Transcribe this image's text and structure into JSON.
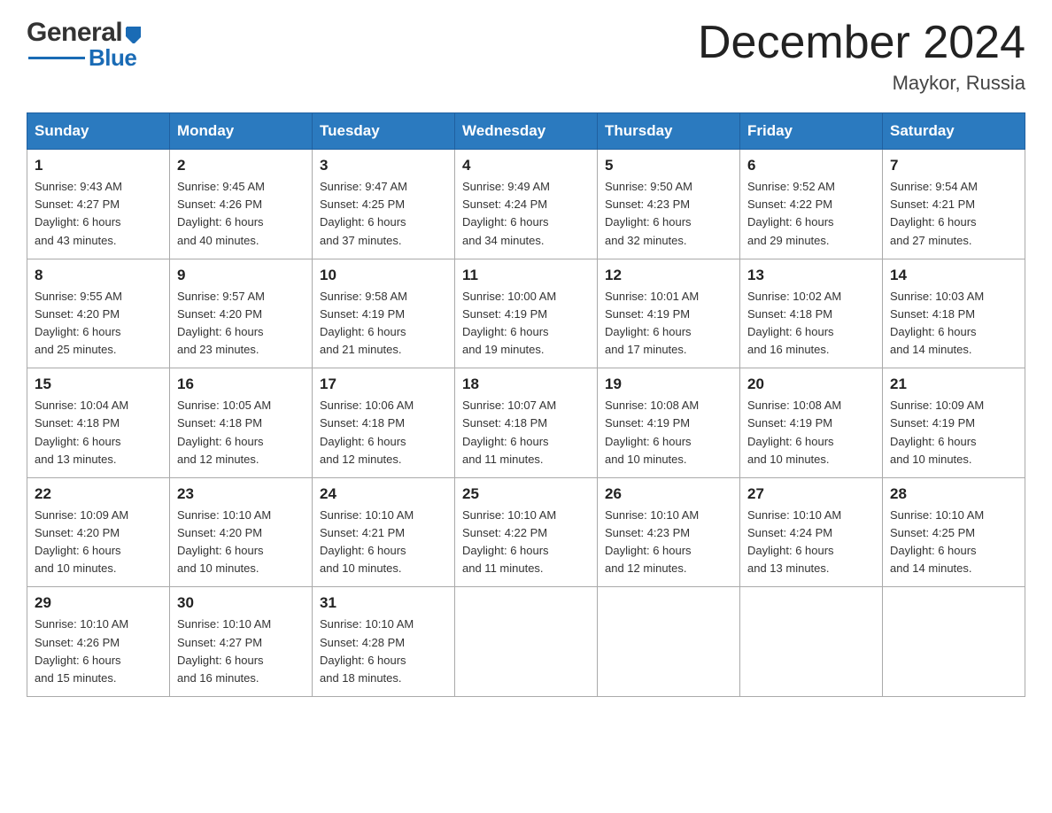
{
  "header": {
    "logo_general": "General",
    "logo_blue": "Blue",
    "month_title": "December 2024",
    "location": "Maykor, Russia"
  },
  "weekdays": [
    "Sunday",
    "Monday",
    "Tuesday",
    "Wednesday",
    "Thursday",
    "Friday",
    "Saturday"
  ],
  "weeks": [
    [
      {
        "day": "1",
        "sunrise": "9:43 AM",
        "sunset": "4:27 PM",
        "daylight": "6 hours and 43 minutes."
      },
      {
        "day": "2",
        "sunrise": "9:45 AM",
        "sunset": "4:26 PM",
        "daylight": "6 hours and 40 minutes."
      },
      {
        "day": "3",
        "sunrise": "9:47 AM",
        "sunset": "4:25 PM",
        "daylight": "6 hours and 37 minutes."
      },
      {
        "day": "4",
        "sunrise": "9:49 AM",
        "sunset": "4:24 PM",
        "daylight": "6 hours and 34 minutes."
      },
      {
        "day": "5",
        "sunrise": "9:50 AM",
        "sunset": "4:23 PM",
        "daylight": "6 hours and 32 minutes."
      },
      {
        "day": "6",
        "sunrise": "9:52 AM",
        "sunset": "4:22 PM",
        "daylight": "6 hours and 29 minutes."
      },
      {
        "day": "7",
        "sunrise": "9:54 AM",
        "sunset": "4:21 PM",
        "daylight": "6 hours and 27 minutes."
      }
    ],
    [
      {
        "day": "8",
        "sunrise": "9:55 AM",
        "sunset": "4:20 PM",
        "daylight": "6 hours and 25 minutes."
      },
      {
        "day": "9",
        "sunrise": "9:57 AM",
        "sunset": "4:20 PM",
        "daylight": "6 hours and 23 minutes."
      },
      {
        "day": "10",
        "sunrise": "9:58 AM",
        "sunset": "4:19 PM",
        "daylight": "6 hours and 21 minutes."
      },
      {
        "day": "11",
        "sunrise": "10:00 AM",
        "sunset": "4:19 PM",
        "daylight": "6 hours and 19 minutes."
      },
      {
        "day": "12",
        "sunrise": "10:01 AM",
        "sunset": "4:19 PM",
        "daylight": "6 hours and 17 minutes."
      },
      {
        "day": "13",
        "sunrise": "10:02 AM",
        "sunset": "4:18 PM",
        "daylight": "6 hours and 16 minutes."
      },
      {
        "day": "14",
        "sunrise": "10:03 AM",
        "sunset": "4:18 PM",
        "daylight": "6 hours and 14 minutes."
      }
    ],
    [
      {
        "day": "15",
        "sunrise": "10:04 AM",
        "sunset": "4:18 PM",
        "daylight": "6 hours and 13 minutes."
      },
      {
        "day": "16",
        "sunrise": "10:05 AM",
        "sunset": "4:18 PM",
        "daylight": "6 hours and 12 minutes."
      },
      {
        "day": "17",
        "sunrise": "10:06 AM",
        "sunset": "4:18 PM",
        "daylight": "6 hours and 12 minutes."
      },
      {
        "day": "18",
        "sunrise": "10:07 AM",
        "sunset": "4:18 PM",
        "daylight": "6 hours and 11 minutes."
      },
      {
        "day": "19",
        "sunrise": "10:08 AM",
        "sunset": "4:19 PM",
        "daylight": "6 hours and 10 minutes."
      },
      {
        "day": "20",
        "sunrise": "10:08 AM",
        "sunset": "4:19 PM",
        "daylight": "6 hours and 10 minutes."
      },
      {
        "day": "21",
        "sunrise": "10:09 AM",
        "sunset": "4:19 PM",
        "daylight": "6 hours and 10 minutes."
      }
    ],
    [
      {
        "day": "22",
        "sunrise": "10:09 AM",
        "sunset": "4:20 PM",
        "daylight": "6 hours and 10 minutes."
      },
      {
        "day": "23",
        "sunrise": "10:10 AM",
        "sunset": "4:20 PM",
        "daylight": "6 hours and 10 minutes."
      },
      {
        "day": "24",
        "sunrise": "10:10 AM",
        "sunset": "4:21 PM",
        "daylight": "6 hours and 10 minutes."
      },
      {
        "day": "25",
        "sunrise": "10:10 AM",
        "sunset": "4:22 PM",
        "daylight": "6 hours and 11 minutes."
      },
      {
        "day": "26",
        "sunrise": "10:10 AM",
        "sunset": "4:23 PM",
        "daylight": "6 hours and 12 minutes."
      },
      {
        "day": "27",
        "sunrise": "10:10 AM",
        "sunset": "4:24 PM",
        "daylight": "6 hours and 13 minutes."
      },
      {
        "day": "28",
        "sunrise": "10:10 AM",
        "sunset": "4:25 PM",
        "daylight": "6 hours and 14 minutes."
      }
    ],
    [
      {
        "day": "29",
        "sunrise": "10:10 AM",
        "sunset": "4:26 PM",
        "daylight": "6 hours and 15 minutes."
      },
      {
        "day": "30",
        "sunrise": "10:10 AM",
        "sunset": "4:27 PM",
        "daylight": "6 hours and 16 minutes."
      },
      {
        "day": "31",
        "sunrise": "10:10 AM",
        "sunset": "4:28 PM",
        "daylight": "6 hours and 18 minutes."
      },
      null,
      null,
      null,
      null
    ]
  ],
  "labels": {
    "sunrise": "Sunrise:",
    "sunset": "Sunset:",
    "daylight": "Daylight:"
  }
}
